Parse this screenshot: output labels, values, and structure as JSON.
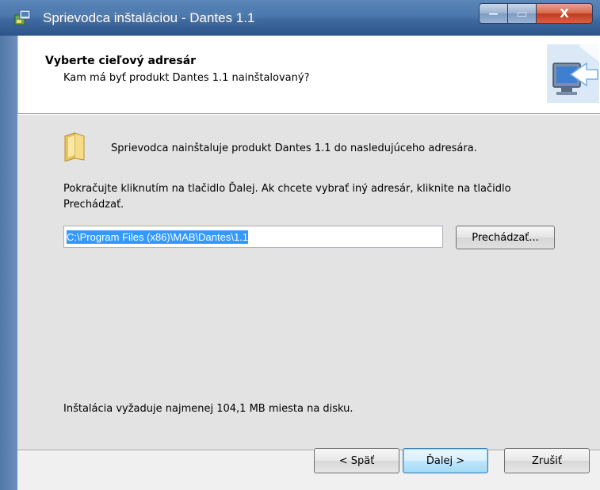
{
  "window": {
    "title": "Sprievodca inštaláciou - Dantes 1.1",
    "minimize_glyph": "—",
    "maximize_glyph": "▭",
    "close_glyph": "X"
  },
  "header": {
    "heading": "Vyberte cieľový adresár",
    "subheading": "Kam má byť produkt Dantes 1.1 nainštalovaný?"
  },
  "content": {
    "intro": "Sprievodca nainštaluje produkt Dantes 1.1 do nasledujúceho adresára.",
    "instruction": "Pokračujte kliknutím na tlačidlo Ďalej. Ak chcete vybrať iný adresár, kliknite na tlačidlo Prechádzať.",
    "path_value": "C:\\Program Files (x86)\\MAB\\Dantes\\1.1",
    "browse_label": "Prechádzať...",
    "space_requirement": "Inštalácia vyžaduje najmenej 104,1 MB miesta na disku."
  },
  "footer": {
    "back_label": "< Späť",
    "next_label": "Ďalej >",
    "cancel_label": "Zrušiť"
  },
  "icons": {
    "app": "installer-app-icon",
    "folder": "folder-icon",
    "wizard": "computer-arrow-icon"
  }
}
